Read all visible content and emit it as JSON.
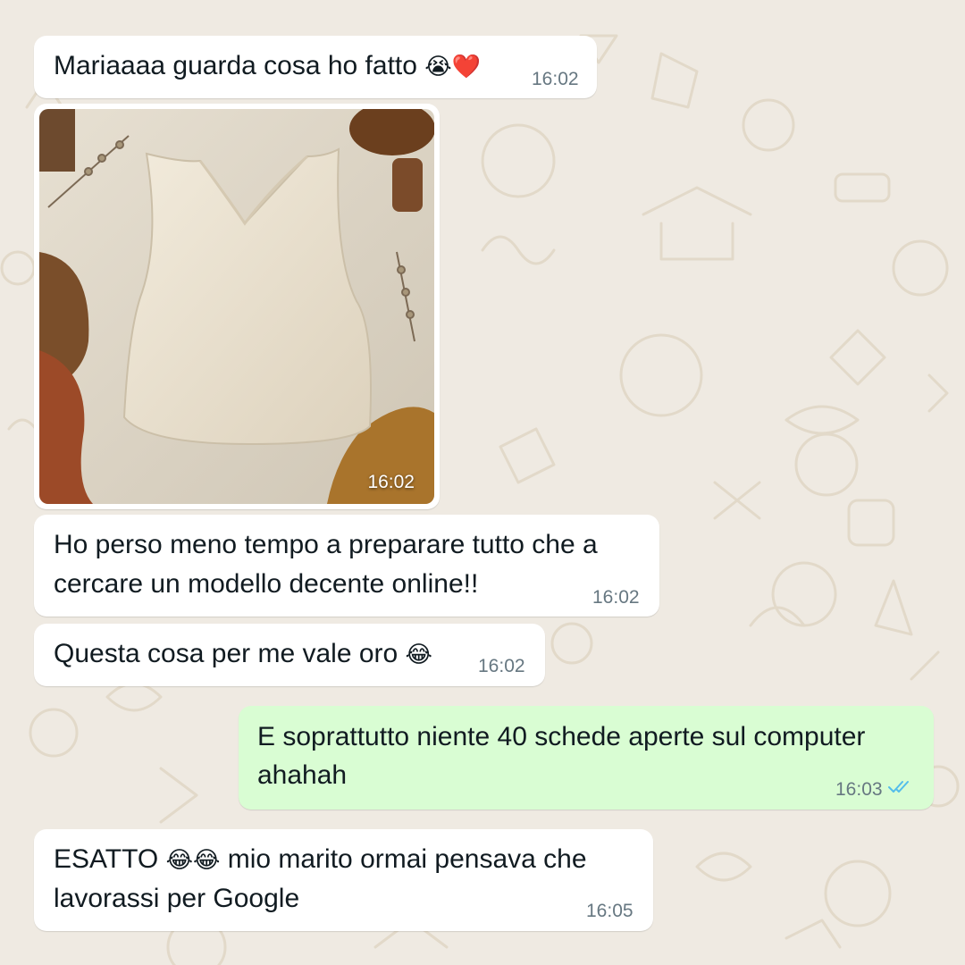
{
  "chat": {
    "messages": [
      {
        "id": "m1",
        "direction": "in",
        "text": "Mariaaaa guarda cosa ho fatto",
        "emoji": "😭❤️",
        "time": "16:02"
      },
      {
        "id": "m2",
        "direction": "in",
        "type": "image",
        "image_description": "cream sleeveless V-neck top laid flat with spools of thread and rust-colored fabric",
        "time": "16:02"
      },
      {
        "id": "m3",
        "direction": "in",
        "lines": [
          "Ho perso meno tempo a preparare tutto che a",
          "cercare un modello decente online!!"
        ],
        "time": "16:02"
      },
      {
        "id": "m4",
        "direction": "in",
        "text": "Questa cosa per me vale oro",
        "emoji": "😂",
        "time": "16:02"
      },
      {
        "id": "m5",
        "direction": "out",
        "lines": [
          "E soprattutto niente 40 schede aperte sul computer",
          "ahahah"
        ],
        "time": "16:03",
        "status": "read"
      },
      {
        "id": "m6",
        "direction": "in",
        "line1_prefix": "ESATTO",
        "line1_emoji": "😂😂",
        "line1_suffix": "mio marito ormai pensava che",
        "line2": "lavorassi per Google",
        "time": "16:05"
      }
    ]
  },
  "colors": {
    "background": "#efeae2",
    "incoming_bubble": "#ffffff",
    "outgoing_bubble": "#d9fdd3",
    "timestamp": "#667781",
    "read_ticks": "#53bdeb"
  },
  "icons": {
    "read_status": "double-check-icon"
  }
}
